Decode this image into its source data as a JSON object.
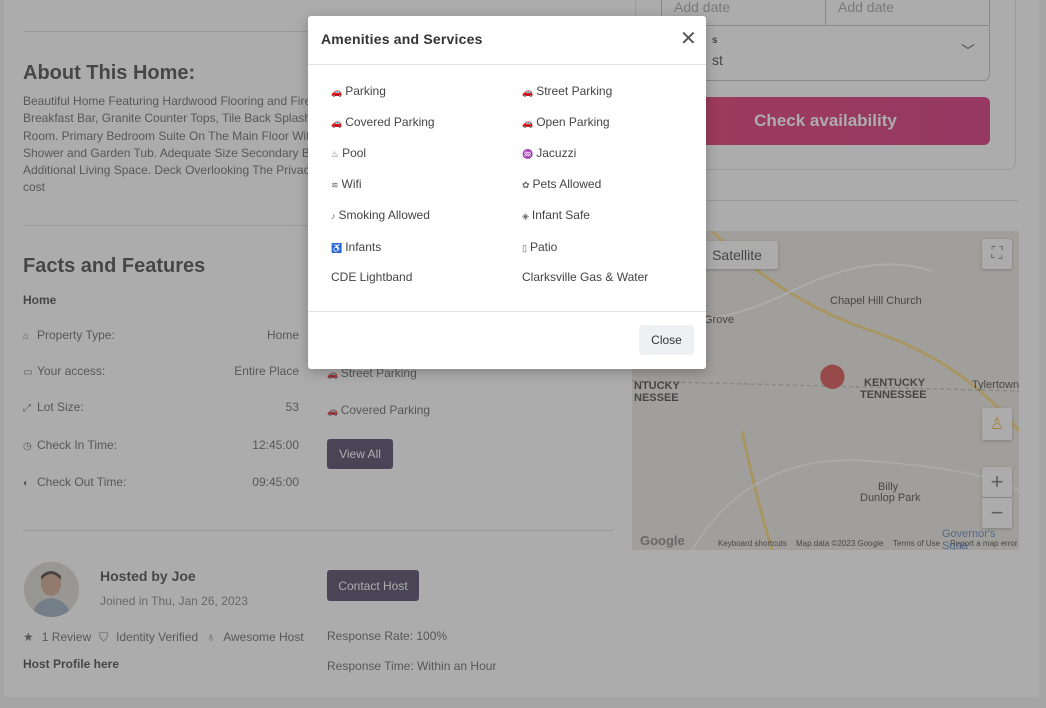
{
  "about": {
    "title": "About This Home:",
    "lines": [
      "Beautiful Home Featuring Hardwood Flooring and Firepl",
      "Breakfast Bar, Granite Counter Tops, Tile Back Splash, S",
      "Room. Primary Bedroom Suite On The Main Floor With",
      "Shower and Garden Tub. Adequate Size Secondary Bec",
      "Additional Living Space. Deck Overlooking The Privacy",
      "cost"
    ]
  },
  "facts": {
    "title": "Facts and Features",
    "subtitle": "Home",
    "rows": [
      {
        "icon": "home-icon",
        "glyph": "⌂",
        "label": "Property Type:",
        "value": "Home"
      },
      {
        "icon": "bed-icon",
        "glyph": "▭",
        "label": "Your access:",
        "value": "Entire Place"
      },
      {
        "icon": "resize-icon",
        "glyph": "⤢",
        "label": "Lot Size:",
        "value": "53"
      },
      {
        "icon": "clock-icon",
        "glyph": "◷",
        "label": "Check In Time:",
        "value": "12:45:00"
      },
      {
        "icon": "clock-half-icon",
        "glyph": "◐",
        "label": "Check Out Time:",
        "value": "09:45:00"
      }
    ],
    "amenities_preview": [
      "Street Parking",
      "Covered Parking"
    ],
    "view_all": "View All"
  },
  "host": {
    "name": "Hosted by Joe",
    "joined": "Joined in Thu, Jan 26, 2023",
    "reviews": "1 Review",
    "verified": "Identity Verified",
    "awesome": "Awesome Host",
    "profile_link": "Host Profile here",
    "contact": "Contact Host",
    "response_rate": "Response Rate: 100%",
    "response_time": "Response Time: Within an Hour"
  },
  "booking": {
    "checkin_placeholder": "Add date",
    "checkout_placeholder": "Add date",
    "guests_label": "s",
    "guests_value": "st",
    "check_button": "Check availability"
  },
  "map": {
    "satellite": "Satellite",
    "labels": [
      "Chapel Hill Church",
      "Grove",
      "KENTUCKY",
      "TENNESSEE",
      "NTUCKY",
      "NESSEE",
      "Tylertown",
      "Billy",
      "Dunlop Park",
      "Governor's Squa"
    ],
    "footer": [
      "Keyboard shortcuts",
      "Map data ©2023 Google",
      "Terms of Use",
      "Report a map error"
    ],
    "logo": "Google"
  },
  "modal": {
    "title": "Amenities and Services",
    "amenities": [
      {
        "label": "Parking",
        "icon": "car-icon",
        "glyph": "🚗"
      },
      {
        "label": "Street Parking",
        "icon": "car-icon",
        "glyph": "🚗"
      },
      {
        "label": "Covered Parking",
        "icon": "car-icon",
        "glyph": "🚗"
      },
      {
        "label": "Open Parking",
        "icon": "car-icon",
        "glyph": "🚗"
      },
      {
        "label": "Pool",
        "icon": "pool-icon",
        "glyph": "♨"
      },
      {
        "label": "Jacuzzi",
        "icon": "hot-tub-icon",
        "glyph": "♒"
      },
      {
        "label": "Wifi",
        "icon": "wifi-icon",
        "glyph": "≋"
      },
      {
        "label": "Pets Allowed",
        "icon": "paw-icon",
        "glyph": "✿"
      },
      {
        "label": "Smoking Allowed",
        "icon": "smoking-icon",
        "glyph": "♪"
      },
      {
        "label": "Infant Safe",
        "icon": "tag-icon",
        "glyph": "◈"
      },
      {
        "label": "Infants",
        "icon": "stroller-icon",
        "glyph": "♿"
      },
      {
        "label": "Patio",
        "icon": "patio-icon",
        "glyph": "▯"
      },
      {
        "label": "CDE Lightband",
        "icon": "",
        "glyph": ""
      },
      {
        "label": "Clarksville Gas & Water",
        "icon": "",
        "glyph": ""
      }
    ],
    "close_button": "Close"
  }
}
